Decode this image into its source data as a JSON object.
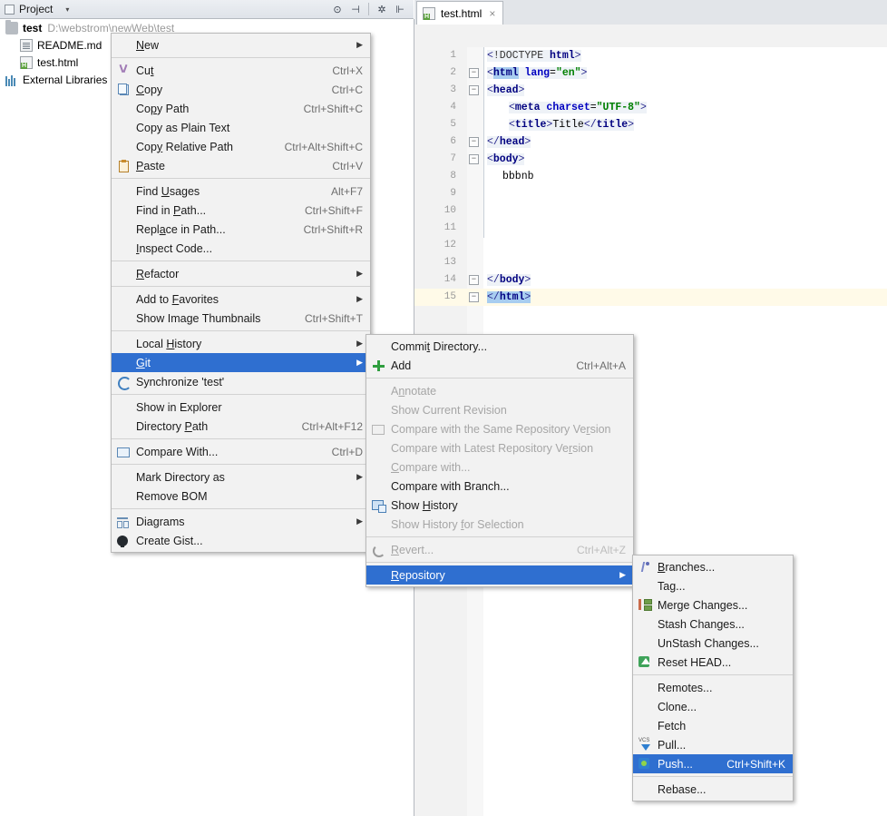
{
  "tool_window": {
    "title": "Project",
    "caret": "▾",
    "actions": [
      {
        "name": "locate-icon",
        "glyph": "⊙"
      },
      {
        "name": "collapse-all-icon",
        "glyph": "⊣"
      },
      {
        "name": "settings-gear-icon",
        "glyph": "✲"
      },
      {
        "name": "hide-icon",
        "glyph": "⊩"
      }
    ]
  },
  "project_tree": [
    {
      "icon": "folder-icon",
      "label": "test",
      "path": "D:\\webstrom\\newWeb\\test",
      "bold": true
    },
    {
      "icon": "markdown-file-icon",
      "label": "README.md",
      "path": "",
      "bold": false
    },
    {
      "icon": "html-file-icon",
      "label": "test.html",
      "path": "",
      "bold": false
    },
    {
      "icon": "library-icon",
      "label": "External Libraries",
      "path": "",
      "bold": false
    }
  ],
  "editor": {
    "tab": {
      "label": "test.html",
      "close": "×",
      "icon": "html-file-icon"
    },
    "lines": [
      {
        "no": "1",
        "fold": "",
        "indent": 0
      },
      {
        "no": "2",
        "fold": "−",
        "indent": 0
      },
      {
        "no": "3",
        "fold": "−",
        "indent": 0
      },
      {
        "no": "4",
        "fold": "",
        "indent": 1
      },
      {
        "no": "5",
        "fold": "",
        "indent": 1
      },
      {
        "no": "6",
        "fold": "−",
        "indent": 0
      },
      {
        "no": "7",
        "fold": "−",
        "indent": 0
      },
      {
        "no": "8",
        "fold": "",
        "indent": 1
      },
      {
        "no": "9",
        "fold": "",
        "indent": 0
      },
      {
        "no": "10",
        "fold": "",
        "indent": 0
      },
      {
        "no": "11",
        "fold": "",
        "indent": 0
      },
      {
        "no": "12",
        "fold": "",
        "indent": 0
      },
      {
        "no": "13",
        "fold": "",
        "indent": 0
      },
      {
        "no": "14",
        "fold": "−",
        "indent": 0
      },
      {
        "no": "15",
        "fold": "−",
        "indent": 0
      }
    ],
    "code": {
      "l1": "<!DOCTYPE html>",
      "l2": "<html lang=\"en\">",
      "l3": "<head>",
      "l4": "<meta charset=\"UTF-8\">",
      "l5": "<title>Title</title>",
      "l6": "</head>",
      "l7": "<body>",
      "l8": "bbbnb",
      "l14": "</body>",
      "l15": "</html>"
    }
  },
  "context_menu": {
    "name": "project-context-menu",
    "items": [
      {
        "label": "New",
        "key": "",
        "arrow": true,
        "icon": "",
        "disabled": false,
        "selected": false,
        "sep_after": true,
        "accel": 0
      },
      {
        "label": "Cut",
        "key": "Ctrl+X",
        "arrow": false,
        "icon": "cut-icon",
        "disabled": false,
        "selected": false,
        "sep_after": false,
        "accel": 2
      },
      {
        "label": "Copy",
        "key": "Ctrl+C",
        "arrow": false,
        "icon": "copy-icon",
        "disabled": false,
        "selected": false,
        "sep_after": false,
        "accel": 0
      },
      {
        "label": "Copy Path",
        "key": "Ctrl+Shift+C",
        "arrow": false,
        "icon": "",
        "disabled": false,
        "selected": false,
        "sep_after": false,
        "accel": 2
      },
      {
        "label": "Copy as Plain Text",
        "key": "",
        "arrow": false,
        "icon": "",
        "disabled": false,
        "selected": false,
        "sep_after": false,
        "accel": -1
      },
      {
        "label": "Copy Relative Path",
        "key": "Ctrl+Alt+Shift+C",
        "arrow": false,
        "icon": "",
        "disabled": false,
        "selected": false,
        "sep_after": false,
        "accel": 3
      },
      {
        "label": "Paste",
        "key": "Ctrl+V",
        "arrow": false,
        "icon": "paste-icon",
        "disabled": false,
        "selected": false,
        "sep_after": true,
        "accel": 0
      },
      {
        "label": "Find Usages",
        "key": "Alt+F7",
        "arrow": false,
        "icon": "",
        "disabled": false,
        "selected": false,
        "sep_after": false,
        "accel": 5
      },
      {
        "label": "Find in Path...",
        "key": "Ctrl+Shift+F",
        "arrow": false,
        "icon": "",
        "disabled": false,
        "selected": false,
        "sep_after": false,
        "accel": 8
      },
      {
        "label": "Replace in Path...",
        "key": "Ctrl+Shift+R",
        "arrow": false,
        "icon": "",
        "disabled": false,
        "selected": false,
        "sep_after": false,
        "accel": 4
      },
      {
        "label": "Inspect Code...",
        "key": "",
        "arrow": false,
        "icon": "",
        "disabled": false,
        "selected": false,
        "sep_after": true,
        "accel": 0
      },
      {
        "label": "Refactor",
        "key": "",
        "arrow": true,
        "icon": "",
        "disabled": false,
        "selected": false,
        "sep_after": true,
        "accel": 0
      },
      {
        "label": "Add to Favorites",
        "key": "",
        "arrow": true,
        "icon": "",
        "disabled": false,
        "selected": false,
        "sep_after": false,
        "accel": 7
      },
      {
        "label": "Show Image Thumbnails",
        "key": "Ctrl+Shift+T",
        "arrow": false,
        "icon": "",
        "disabled": false,
        "selected": false,
        "sep_after": true,
        "accel": -1
      },
      {
        "label": "Local History",
        "key": "",
        "arrow": true,
        "icon": "",
        "disabled": false,
        "selected": false,
        "sep_after": false,
        "accel": 6
      },
      {
        "label": "Git",
        "key": "",
        "arrow": true,
        "icon": "",
        "disabled": false,
        "selected": true,
        "sep_after": false,
        "accel": 0
      },
      {
        "label": "Synchronize 'test'",
        "key": "",
        "arrow": false,
        "icon": "sync-icon",
        "disabled": false,
        "selected": false,
        "sep_after": true,
        "accel": -1
      },
      {
        "label": "Show in Explorer",
        "key": "",
        "arrow": false,
        "icon": "",
        "disabled": false,
        "selected": false,
        "sep_after": false,
        "accel": -1
      },
      {
        "label": "Directory Path",
        "key": "Ctrl+Alt+F12",
        "arrow": false,
        "icon": "",
        "disabled": false,
        "selected": false,
        "sep_after": true,
        "accel": 10
      },
      {
        "label": "Compare With...",
        "key": "Ctrl+D",
        "arrow": false,
        "icon": "compare-icon",
        "disabled": false,
        "selected": false,
        "sep_after": true,
        "accel": -1
      },
      {
        "label": "Mark Directory as",
        "key": "",
        "arrow": true,
        "icon": "",
        "disabled": false,
        "selected": false,
        "sep_after": false,
        "accel": -1
      },
      {
        "label": "Remove BOM",
        "key": "",
        "arrow": false,
        "icon": "",
        "disabled": false,
        "selected": false,
        "sep_after": true,
        "accel": -1
      },
      {
        "label": "Diagrams",
        "key": "",
        "arrow": true,
        "icon": "diagrams-icon",
        "disabled": false,
        "selected": false,
        "sep_after": false,
        "accel": -1
      },
      {
        "label": "Create Gist...",
        "key": "",
        "arrow": false,
        "icon": "github-gist-icon",
        "disabled": false,
        "selected": false,
        "sep_after": false,
        "accel": -1
      }
    ]
  },
  "git_menu": {
    "name": "git-submenu",
    "items": [
      {
        "label": "Commit Directory...",
        "key": "",
        "arrow": false,
        "icon": "",
        "disabled": false,
        "selected": false,
        "sep_after": false,
        "accel": 5
      },
      {
        "label": "Add",
        "key": "Ctrl+Alt+A",
        "arrow": false,
        "icon": "add-icon",
        "disabled": false,
        "selected": false,
        "sep_after": true,
        "accel": -1
      },
      {
        "label": "Annotate",
        "key": "",
        "arrow": false,
        "icon": "",
        "disabled": true,
        "selected": false,
        "sep_after": false,
        "accel": 1
      },
      {
        "label": "Show Current Revision",
        "key": "",
        "arrow": false,
        "icon": "",
        "disabled": true,
        "selected": false,
        "sep_after": false,
        "accel": -1
      },
      {
        "label": "Compare with the Same Repository Version",
        "key": "",
        "arrow": false,
        "icon": "compare-grey-icon",
        "disabled": true,
        "selected": false,
        "sep_after": false,
        "accel": 35
      },
      {
        "label": "Compare with Latest Repository Version",
        "key": "",
        "arrow": false,
        "icon": "",
        "disabled": true,
        "selected": false,
        "sep_after": false,
        "accel": 33
      },
      {
        "label": "Compare with...",
        "key": "",
        "arrow": false,
        "icon": "",
        "disabled": true,
        "selected": false,
        "sep_after": false,
        "accel": 0
      },
      {
        "label": "Compare with Branch...",
        "key": "",
        "arrow": false,
        "icon": "",
        "disabled": false,
        "selected": false,
        "sep_after": false,
        "accel": -1
      },
      {
        "label": "Show History",
        "key": "",
        "arrow": false,
        "icon": "show-history-icon",
        "disabled": false,
        "selected": false,
        "sep_after": false,
        "accel": 5
      },
      {
        "label": "Show History for Selection",
        "key": "",
        "arrow": false,
        "icon": "",
        "disabled": true,
        "selected": false,
        "sep_after": true,
        "accel": 13
      },
      {
        "label": "Revert...",
        "key": "Ctrl+Alt+Z",
        "arrow": false,
        "icon": "revert-icon",
        "disabled": true,
        "selected": false,
        "sep_after": true,
        "accel": 0
      },
      {
        "label": "Repository",
        "key": "",
        "arrow": true,
        "icon": "",
        "disabled": false,
        "selected": true,
        "sep_after": false,
        "accel": 0
      }
    ]
  },
  "repository_menu": {
    "name": "repository-submenu",
    "items": [
      {
        "label": "Branches...",
        "key": "",
        "arrow": false,
        "icon": "branches-icon",
        "disabled": false,
        "selected": false,
        "sep_after": false,
        "accel": 0
      },
      {
        "label": "Tag...",
        "key": "",
        "arrow": false,
        "icon": "",
        "disabled": false,
        "selected": false,
        "sep_after": false,
        "accel": -1
      },
      {
        "label": "Merge Changes...",
        "key": "",
        "arrow": false,
        "icon": "merge-icon",
        "disabled": false,
        "selected": false,
        "sep_after": false,
        "accel": -1
      },
      {
        "label": "Stash Changes...",
        "key": "",
        "arrow": false,
        "icon": "",
        "disabled": false,
        "selected": false,
        "sep_after": false,
        "accel": -1
      },
      {
        "label": "UnStash Changes...",
        "key": "",
        "arrow": false,
        "icon": "",
        "disabled": false,
        "selected": false,
        "sep_after": false,
        "accel": -1
      },
      {
        "label": "Reset HEAD...",
        "key": "",
        "arrow": false,
        "icon": "reset-head-icon",
        "disabled": false,
        "selected": false,
        "sep_after": true,
        "accel": -1
      },
      {
        "label": "Remotes...",
        "key": "",
        "arrow": false,
        "icon": "",
        "disabled": false,
        "selected": false,
        "sep_after": false,
        "accel": -1
      },
      {
        "label": "Clone...",
        "key": "",
        "arrow": false,
        "icon": "",
        "disabled": false,
        "selected": false,
        "sep_after": false,
        "accel": -1
      },
      {
        "label": "Fetch",
        "key": "",
        "arrow": false,
        "icon": "",
        "disabled": false,
        "selected": false,
        "sep_after": false,
        "accel": -1
      },
      {
        "label": "Pull...",
        "key": "",
        "arrow": false,
        "icon": "pull-icon",
        "disabled": false,
        "selected": false,
        "sep_after": false,
        "accel": -1
      },
      {
        "label": "Push...",
        "key": "Ctrl+Shift+K",
        "arrow": false,
        "icon": "push-icon",
        "disabled": false,
        "selected": true,
        "sep_after": true,
        "accel": -1
      },
      {
        "label": "Rebase...",
        "key": "",
        "arrow": false,
        "icon": "",
        "disabled": false,
        "selected": false,
        "sep_after": false,
        "accel": -1
      }
    ]
  },
  "colors": {
    "selection_blue": "#2f6fd0",
    "menu_bg": "#f2f2f2",
    "disabled_text": "#a6a6a6",
    "current_line": "#fffae8"
  }
}
